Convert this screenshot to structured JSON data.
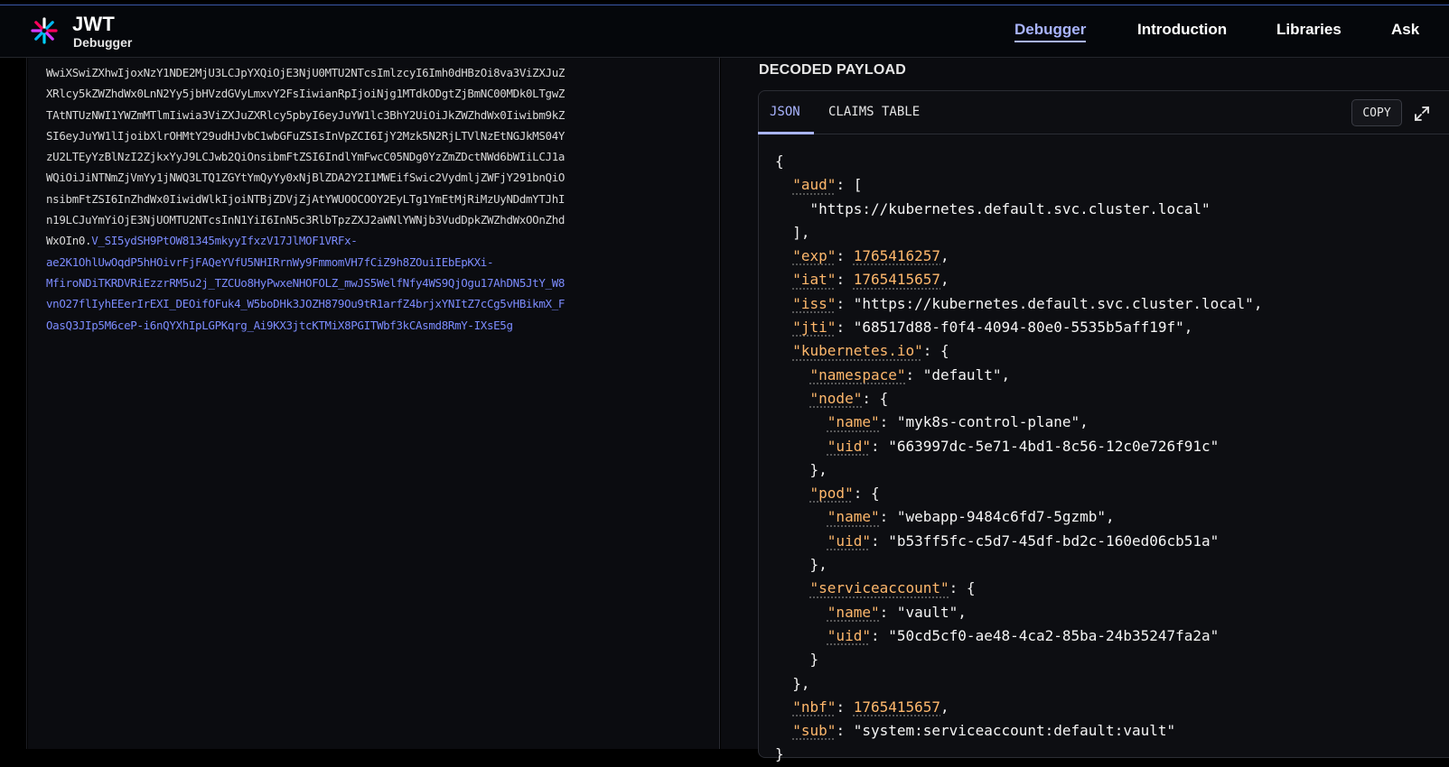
{
  "header": {
    "brand_title": "JWT",
    "brand_subtitle": "Debugger",
    "nav": [
      "Debugger",
      "Introduction",
      "Libraries",
      "Ask"
    ]
  },
  "token": {
    "payload_lines": [
      "WwiXSwiZXhwIjoxNzY1NDE2MjU3LCJpYXQiOjE3NjU0MTU2NTcsImlzcyI6Imh0dHBzOi8va3ViZXJuZ",
      "XRlcy5kZWZhdWx0LnN2Yy5jbHVzdGVyLmxvY2FsIiwianRpIjoiNjg1MTdkODgtZjBmNC00MDk0LTgwZ",
      "TAtNTUzNWI1YWZmMTlmIiwia3ViZXJuZXRlcy5pbyI6eyJuYW1lc3BhY2UiOiJkZWZhdWx0Iiwibm9kZ",
      "SI6eyJuYW1lIjoibXlrOHMtY29udHJvbC1wbGFuZSIsInVpZCI6IjY2Mzk5N2RjLTVlNzEtNGJkMS04Y",
      "zU2LTEyYzBlNzI2ZjkxYyJ9LCJwb2QiOnsibmFtZSI6IndlYmFwcC05NDg0YzZmZDctNWd6bWIiLCJ1a",
      "WQiOiJiNTNmZjVmYy1jNWQ3LTQ1ZGYtYmQyYy0xNjBlZDA2Y2I1MWEifSwic2VydmljZWFjY291bnQiO",
      "nsibmFtZSI6InZhdWx0Iiwid",
      "WlkIjoiNTBjZDVjZjAtYWUOOCOOY2EyLTg1YmEtMjRiMzUyNDdmYTJhI",
      "n19LCJuYmYiOjE3NjUOMTU2NTcsInN1YiI6InN5c3RlbTpzZXJ2aWNlYWNjb3VudDpkZWZhdWxOOnZhd",
      "WxOIn0."
    ],
    "signature_lines": [
      "V_SI5ydSH9PtOW81345mkyyIfxzV17JlMOF1VRFx-",
      "ae2K1OhlUwOqdP5hHOivrFjFAQeYVfU5NHIRrnWy9FmmomVH7fCiZ9h8ZOuiIEbEpKXi-",
      "MfiroNDiTKRDVRiEzzrRM5u2j_TZCUo8HyPwxeNHOFOLZ_mwJS5WelfNfy4WS9QjOgu17AhDN5JtY_W8",
      "vnO27flIyhEEerIrEXI_DEOifOFuk4_W5boDHk3JOZH879Ou9tR1arfZ4brjxYNItZ7cCg5vHBikmX_F",
      "OasQ3JIp5M6ceP-i6nQYXhIpLGPKqrg_Ai9KX3jtcKTMiX8PGITWbf3kCAsmd8RmY-IXsE5g"
    ]
  },
  "decoded": {
    "title": "DECODED PAYLOAD",
    "tabs": [
      "JSON",
      "CLAIMS TABLE"
    ],
    "copy_label": "COPY",
    "payload": {
      "aud": [
        "https://kubernetes.default.svc.cluster.local"
      ],
      "exp": 1765416257,
      "iat": 1765415657,
      "iss": "https://kubernetes.default.svc.cluster.local",
      "jti": "68517d88-f0f4-4094-80e0-5535b5aff19f",
      "kubernetes.io": {
        "namespace": "default",
        "node": {
          "name": "myk8s-control-plane",
          "uid": "663997dc-5e71-4bd1-8c56-12c0e726f91c"
        },
        "pod": {
          "name": "webapp-9484c6fd7-5gzmb",
          "uid": "b53ff5fc-c5d7-45df-bd2c-160ed06cb51a"
        },
        "serviceaccount": {
          "name": "vault",
          "uid": "50cd5cf0-ae48-4ca2-85ba-24b35247fa2a"
        }
      },
      "nbf": 1765415657,
      "sub": "system:serviceaccount:default:vault"
    }
  }
}
